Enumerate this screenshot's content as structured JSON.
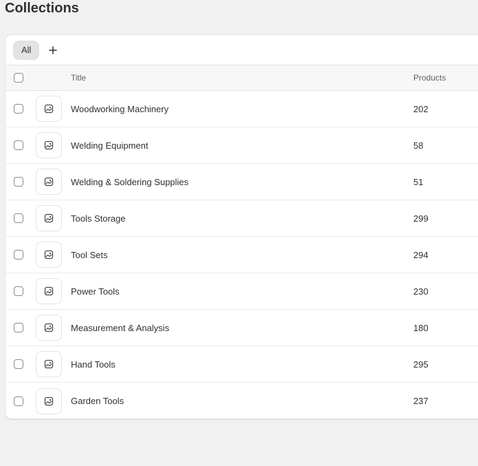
{
  "page": {
    "title": "Collections"
  },
  "tabs": {
    "items": [
      {
        "label": "All",
        "active": true
      }
    ],
    "add_icon": "plus-icon"
  },
  "table": {
    "columns": {
      "title": "Title",
      "products": "Products"
    },
    "thumbnail_icon": "image-placeholder-icon",
    "rows": [
      {
        "title": "Woodworking Machinery",
        "products": "202"
      },
      {
        "title": "Welding Equipment",
        "products": "58"
      },
      {
        "title": "Welding & Soldering Supplies",
        "products": "51"
      },
      {
        "title": "Tools Storage",
        "products": "299"
      },
      {
        "title": "Tool Sets",
        "products": "294"
      },
      {
        "title": "Power Tools",
        "products": "230"
      },
      {
        "title": "Measurement & Analysis",
        "products": "180"
      },
      {
        "title": "Hand Tools",
        "products": "295"
      },
      {
        "title": "Garden Tools",
        "products": "237"
      }
    ]
  },
  "colors": {
    "background": "#f1f1f1",
    "card": "#ffffff",
    "text": "#303030",
    "muted_text": "#616161",
    "border": "#e3e3e3",
    "active_tab": "#e3e3e3"
  }
}
